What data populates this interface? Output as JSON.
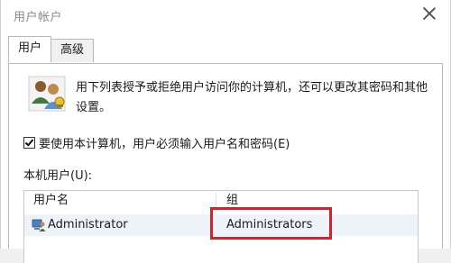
{
  "window": {
    "title": "用户帐户"
  },
  "tabs": [
    {
      "label": "用户",
      "active": true
    },
    {
      "label": "高级",
      "active": false
    }
  ],
  "description": "用下列表授予或拒绝用户访问你的计算机，还可以更改其密码和其他设置。",
  "require_login": {
    "label": "要使用本计算机，用户必须输入用户名和密码(E)",
    "checked": true
  },
  "users_section": {
    "label": "本机用户(U):",
    "columns": [
      "用户名",
      "组"
    ],
    "rows": [
      {
        "name": "Administrator",
        "group": "Administrators"
      }
    ]
  },
  "colors": {
    "highlight": "#d8202a"
  },
  "icons": {
    "users": "users-icon",
    "user_row": "user-icon",
    "close": "close-icon"
  }
}
